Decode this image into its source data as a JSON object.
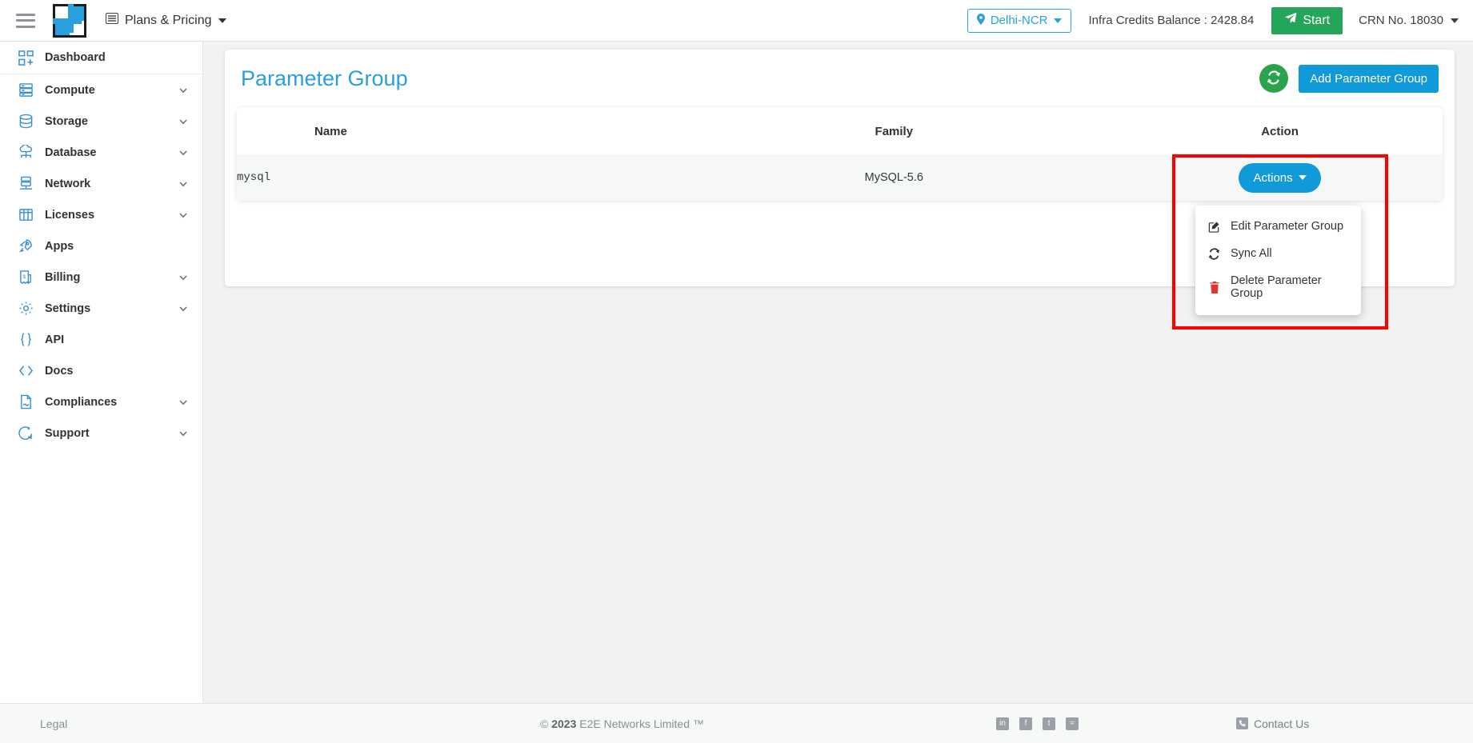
{
  "topbar": {
    "menu_icon": "hamburger-icon",
    "logo_caption": "E2E Networks",
    "plans_label": "Plans & Pricing",
    "region": "Delhi-NCR",
    "credits": "Infra Credits Balance : 2428.84",
    "start_label": "Start",
    "crn": "CRN No. 18030"
  },
  "sidebar": {
    "items": [
      {
        "label": "Dashboard",
        "icon": "dashboard-icon",
        "expandable": false
      },
      {
        "label": "Compute",
        "icon": "server-icon",
        "expandable": true
      },
      {
        "label": "Storage",
        "icon": "database-icon",
        "expandable": true
      },
      {
        "label": "Database",
        "icon": "cloud-db-icon",
        "expandable": true
      },
      {
        "label": "Network",
        "icon": "network-icon",
        "expandable": true
      },
      {
        "label": "Licenses",
        "icon": "license-icon",
        "expandable": true
      },
      {
        "label": "Apps",
        "icon": "rocket-icon",
        "expandable": false
      },
      {
        "label": "Billing",
        "icon": "invoice-icon",
        "expandable": true
      },
      {
        "label": "Settings",
        "icon": "gear-icon",
        "expandable": true
      },
      {
        "label": "API",
        "icon": "braces-icon",
        "expandable": false
      },
      {
        "label": "Docs",
        "icon": "code-icon",
        "expandable": false
      },
      {
        "label": "Compliances",
        "icon": "document-icon",
        "expandable": true
      },
      {
        "label": "Support",
        "icon": "support-icon",
        "expandable": true
      }
    ]
  },
  "main": {
    "title": "Parameter Group",
    "refresh_icon": "refresh-icon",
    "add_button": "Add Parameter Group",
    "table": {
      "columns": [
        "Name",
        "Family",
        "Action"
      ],
      "rows": [
        {
          "name": "mysql",
          "family": "MySQL-5.6",
          "action_label": "Actions"
        }
      ]
    },
    "dropdown": {
      "items": [
        {
          "label": "Edit Parameter Group",
          "icon": "pencil-square-icon",
          "danger": false
        },
        {
          "label": "Sync All",
          "icon": "sync-icon",
          "danger": false
        },
        {
          "label": "Delete Parameter Group",
          "icon": "trash-icon",
          "danger": true
        }
      ]
    }
  },
  "footer": {
    "legal": "Legal",
    "copyright_symbol": "©",
    "copyright_year": "2023",
    "copyright_text": "E2E Networks Limited ™",
    "social": [
      {
        "name": "linkedin-icon",
        "glyph": "in"
      },
      {
        "name": "facebook-icon",
        "glyph": "f"
      },
      {
        "name": "twitter-icon",
        "glyph": "t"
      },
      {
        "name": "rss-icon",
        "glyph": "≈"
      }
    ],
    "contact": "Contact Us"
  },
  "colors": {
    "accent_blue": "#109ada",
    "title_blue": "#29a0dd",
    "green": "#25a55a",
    "refresh_green": "#2aa34d",
    "danger_red": "#e03333",
    "highlight_red": "#fe0000",
    "sidebar_icon": "#3b8fd4"
  }
}
